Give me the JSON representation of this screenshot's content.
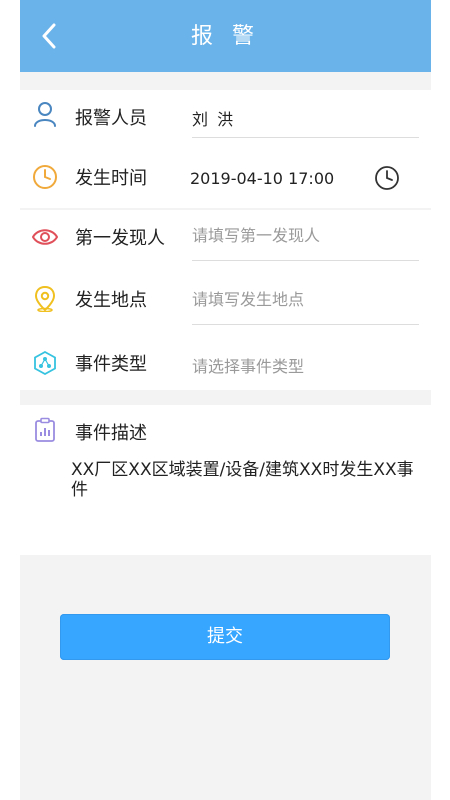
{
  "header": {
    "title": "报 警"
  },
  "form": {
    "reporter": {
      "label": "报警人员",
      "value": "刘 洪"
    },
    "time": {
      "label": "发生时间",
      "value": "2019-04-10 17:00"
    },
    "discoverer": {
      "label": "第一发现人",
      "placeholder": "请填写第一发现人"
    },
    "location": {
      "label": "发生地点",
      "placeholder": "请填写发生地点"
    },
    "event_type": {
      "label": "事件类型",
      "placeholder": "请选择事件类型"
    },
    "description": {
      "label": "事件描述",
      "value": "XX厂区XX区域装置/设备/建筑XX时发生XX事件"
    }
  },
  "submit_label": "提交",
  "colors": {
    "header": "#6ab3ea",
    "submit": "#37a6ff",
    "background": "#f3f3f3"
  },
  "icons": {
    "back": "chevron-left-icon",
    "reporter": "person-icon",
    "time": "clock-icon",
    "time_picker": "clock-icon",
    "discoverer": "eye-icon",
    "location": "location-pin-icon",
    "event_type": "hexagon-network-icon",
    "description": "clipboard-chart-icon"
  }
}
